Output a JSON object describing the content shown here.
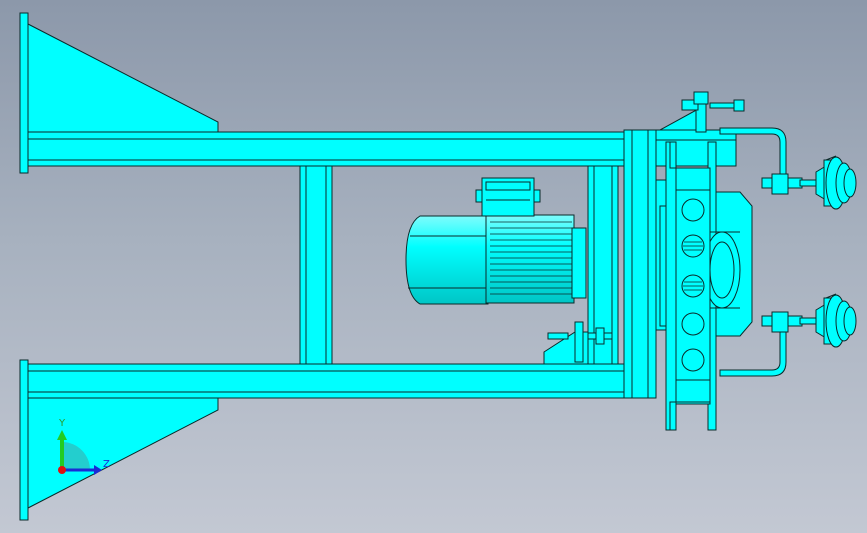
{
  "viewport": {
    "background_top": "#8c98aa",
    "background_bottom": "#c3c8d3"
  },
  "model": {
    "fill_color": "#00ffff",
    "edge_color": "#0a2a2a",
    "shadow_color": "#00c8c8"
  },
  "triad": {
    "y_label": "Y",
    "z_label": "Z",
    "y_color": "#22cc22",
    "z_color": "#1a2bd6",
    "x_color": "#e01010"
  }
}
